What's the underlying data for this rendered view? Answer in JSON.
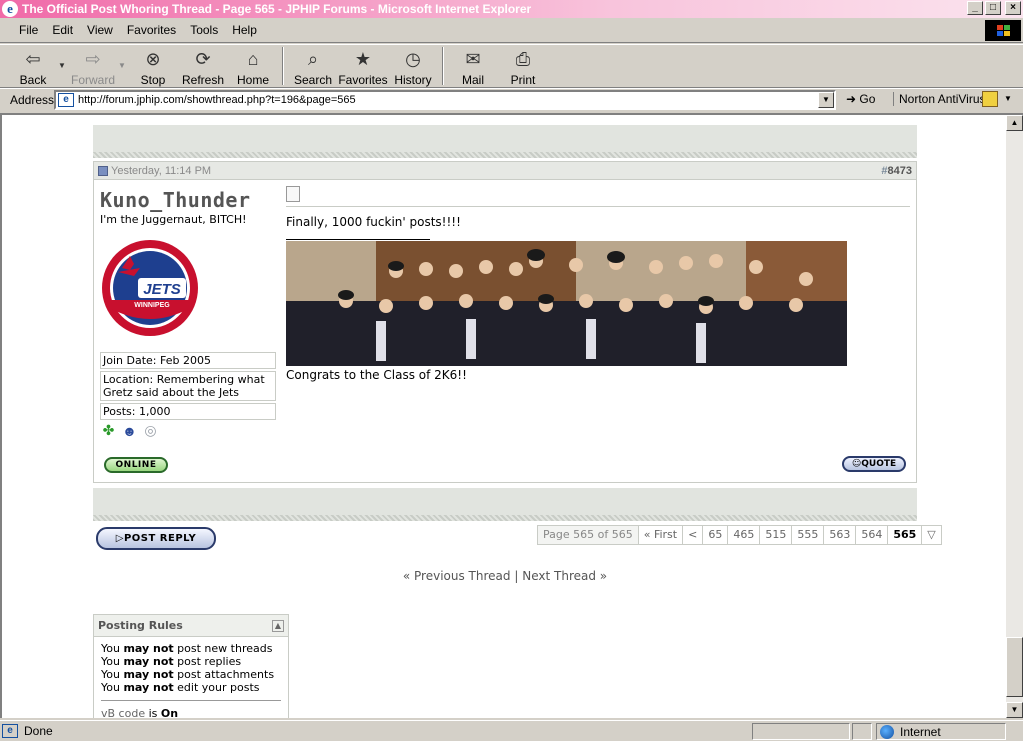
{
  "window": {
    "title": "The Official Post Whoring Thread - Page 565 - JPHIP Forums - Microsoft Internet Explorer",
    "minimize": "_",
    "maximize": "□",
    "close": "×"
  },
  "menu": [
    "File",
    "Edit",
    "View",
    "Favorites",
    "Tools",
    "Help"
  ],
  "toolbar": {
    "back": "Back",
    "forward": "Forward",
    "stop": "Stop",
    "refresh": "Refresh",
    "home": "Home",
    "search": "Search",
    "favorites": "Favorites",
    "history": "History",
    "mail": "Mail",
    "print": "Print"
  },
  "address": {
    "label": "Address",
    "url": "http://forum.jphip.com/showthread.php?t=196&page=565",
    "go": "Go",
    "norton": "Norton AntiVirus"
  },
  "post": {
    "date": "Yesterday, 11:14 PM",
    "number_prefix": "#",
    "number": "8473",
    "username": "Kuno_Thunder",
    "user_title": "I'm the Juggernaut, BITCH!",
    "join_date": "Join Date: Feb 2005",
    "location": "Location: Remembering what Gretz said about the Jets",
    "posts": "Posts: 1,000",
    "online_label": "ONLINE",
    "message": "Finally, 1000 fuckin' posts!!!!",
    "caption": "Congrats to the Class of 2K6!!",
    "quote_label": "QUOTE",
    "avatar_text": "JETS",
    "avatar_subtext": "WINNIPEG"
  },
  "post_reply_label": "POST REPLY",
  "pagenav": {
    "label": "Page 565 of 565",
    "first": "« First",
    "prev": "<",
    "pages": [
      "65",
      "465",
      "515",
      "555",
      "563",
      "564"
    ],
    "current": "565"
  },
  "thread_nav": {
    "prev": "« Previous Thread",
    "sep": "|",
    "next": "Next Thread »"
  },
  "posting_rules": {
    "title": "Posting Rules",
    "rules": [
      {
        "pre": "You ",
        "bold": "may not",
        "post": " post new threads"
      },
      {
        "pre": "You ",
        "bold": "may not",
        "post": " post replies"
      },
      {
        "pre": "You ",
        "bold": "may not",
        "post": " post attachments"
      },
      {
        "pre": "You ",
        "bold": "may not",
        "post": " edit your posts"
      }
    ],
    "vb_code": "vB code",
    "vb_is": " is ",
    "vb_state": "On"
  },
  "status": {
    "text": "Done",
    "zone": "Internet"
  },
  "colors": {
    "title_bar": "#f06aa8",
    "band": "#e1e4df",
    "online_green": "#9ad680"
  }
}
